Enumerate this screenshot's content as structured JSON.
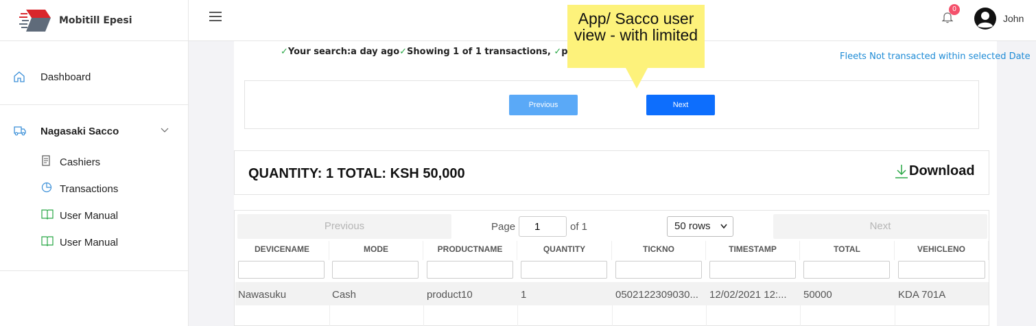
{
  "brand": {
    "name": "Mobitill Epesi"
  },
  "header": {
    "notification_count": "0",
    "username": "John"
  },
  "sidebar": {
    "dashboard_label": "Dashboard",
    "group_label": "Nagasaki Sacco",
    "items": [
      {
        "label": "Cashiers",
        "icon": "receipt-icon"
      },
      {
        "label": "Transactions",
        "icon": "pie-chart-icon"
      },
      {
        "label": "User Manual",
        "icon": "book-icon"
      },
      {
        "label": "User Manual",
        "icon": "book-icon"
      }
    ]
  },
  "search_summary": {
    "search_text": "Your search:a day ago",
    "showing_text": "Showing 1 of 1 transactions,",
    "page_text": "page 0",
    "fleets_link": "Fleets Not transacted within selected Date"
  },
  "callout": {
    "text": "App/ Sacco user view - with limited"
  },
  "pager": {
    "previous_label": "Previous",
    "next_label": "Next"
  },
  "totals": {
    "text": "QUANTITY: 1  TOTAL: KSH 50,000",
    "download_label": "Download"
  },
  "table": {
    "previous_label": "Previous",
    "next_label": "Next",
    "page_label": "Page",
    "page_value": "1",
    "of_label": "of 1",
    "rows_option": "50 rows",
    "columns": [
      "DEVICENAME",
      "MODE",
      "PRODUCTNAME",
      "QUANTITY",
      "TICKNO",
      "TIMESTAMP",
      "TOTAL",
      "VEHICLENO"
    ],
    "rows": [
      [
        "Nawasuku",
        "Cash",
        "product10",
        "1",
        "0502122309030...",
        "12/02/2021 12:...",
        "50000",
        "KDA 701A"
      ]
    ]
  },
  "colors": {
    "accent": "#0d6efd",
    "link": "#1d8bd6",
    "badge": "#f4516c",
    "callout": "#fdf27b",
    "check": "#28a745"
  }
}
